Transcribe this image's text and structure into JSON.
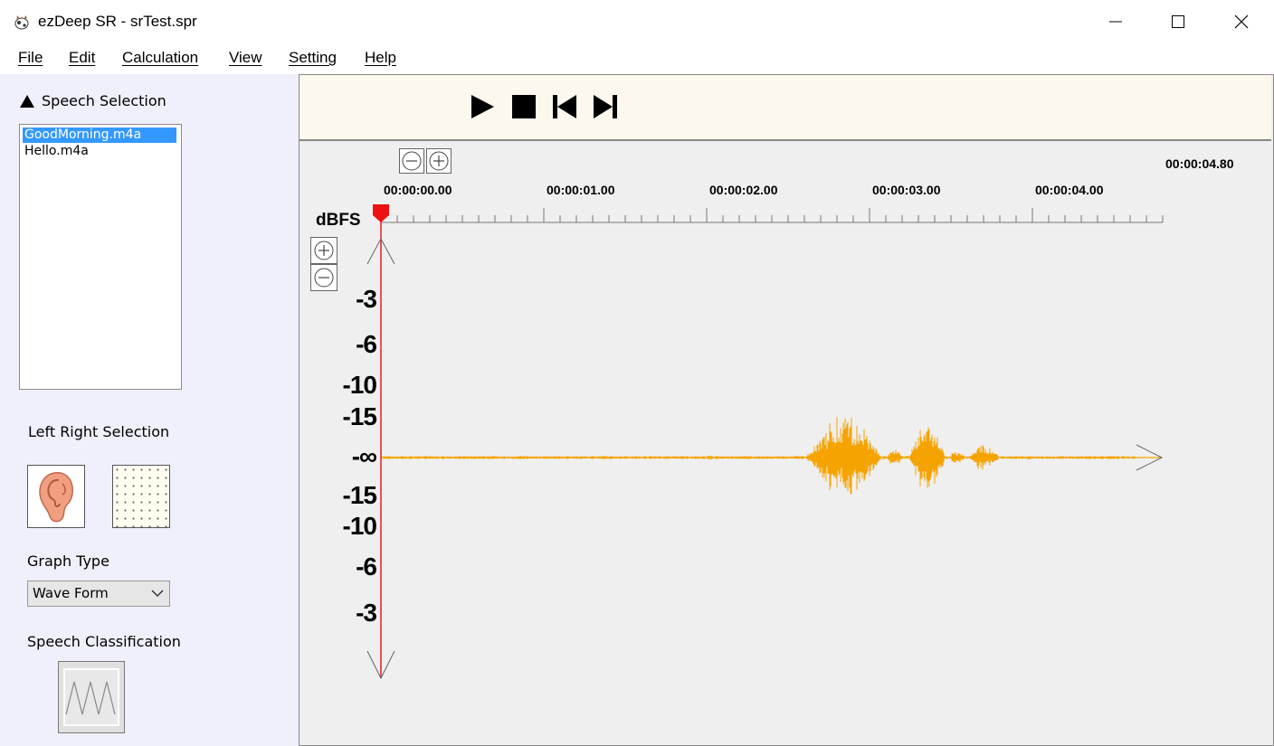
{
  "window": {
    "title": "ezDeep SR - srTest.spr",
    "app_icon": "cow-app-icon",
    "controls": [
      "minimize-icon",
      "maximize-icon",
      "close-icon"
    ]
  },
  "menu": [
    "File",
    "Edit",
    "Calculation",
    "View",
    "Setting",
    "Help"
  ],
  "left_panel": {
    "speech_selection": {
      "toggle_icon": "triangle-up-icon",
      "label": "Speech Selection",
      "files": [
        "GoodMorning.m4a",
        "Hello.m4a"
      ],
      "selected": "GoodMorning.m4a"
    },
    "left_right_selection": {
      "label": "Left Right Selection",
      "left_icon": "ear-icon",
      "right_icon": "dotted-pattern-icon"
    },
    "graph_type": {
      "label": "Graph Type",
      "selected": "Wave Form"
    },
    "speech_classification": {
      "label": "Speech Classification",
      "icon": "zigzag-wave-icon"
    }
  },
  "transport": [
    "play-icon",
    "stop-icon",
    "skip-start-icon",
    "skip-end-icon"
  ],
  "timeline": {
    "labels": [
      "00:00:00.00",
      "00:00:01.00",
      "00:00:02.00",
      "00:00:03.00",
      "00:00:04.00"
    ],
    "total": "00:00:04.80",
    "zoom_buttons": [
      "zoom-out-icon",
      "zoom-in-icon"
    ]
  },
  "amplitude": {
    "unit": "dBFS",
    "labels": [
      "-3",
      "-6",
      "-10",
      "-15",
      "-∞",
      "-15",
      "-10",
      "-6",
      "-3"
    ],
    "zoom_buttons": [
      "zoom-in-icon",
      "zoom-out-icon"
    ]
  },
  "colors": {
    "waveform": "#f5a300",
    "playhead": "#e02020",
    "toolbar_bg": "#fcf8ee",
    "left_panel_bg": "#f0f0fc",
    "selection": "#3399ff"
  }
}
